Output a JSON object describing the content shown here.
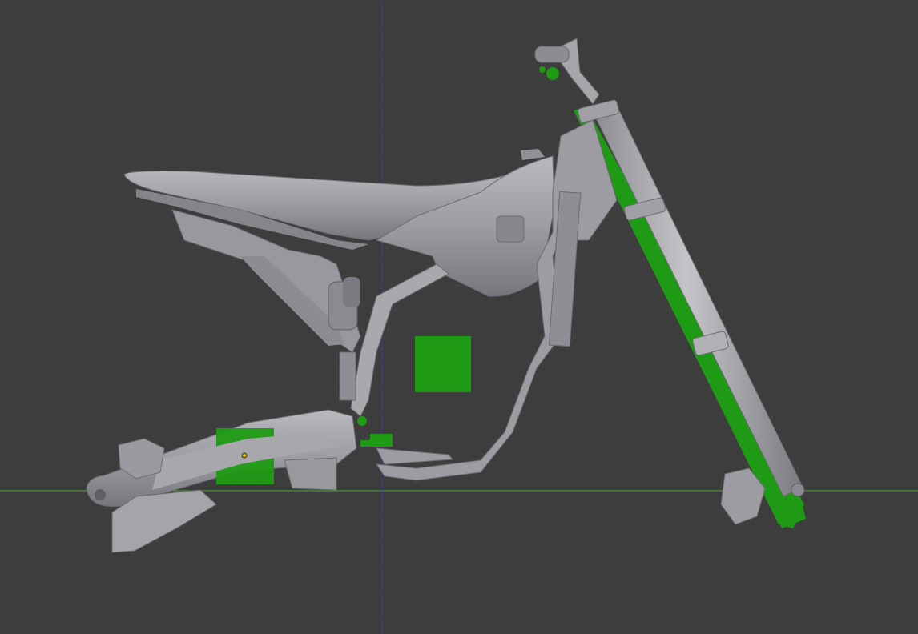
{
  "app": {
    "view": "3d-viewport-right-orthographic"
  },
  "colors": {
    "background": "#3d3d3d",
    "grid": "#474747",
    "x_axis": "#4f9e3c",
    "z_axis": "#3a3aa8",
    "mesh": "#a3a3a8",
    "mesh_dark": "#5f5f66",
    "selected": "#1f9a14",
    "origin": "#e8b000"
  },
  "icons": {
    "origin": "origin-point-icon",
    "empty": "empty-handle-icon"
  },
  "objects": [
    "seat",
    "fuel-tank",
    "rear-subframe",
    "main-frame",
    "rear-shock",
    "swingarm",
    "rear-caliper",
    "chain-guide",
    "front-fork",
    "handlebar",
    "front-caliper",
    "brake-pedal",
    "radiator-shroud"
  ]
}
